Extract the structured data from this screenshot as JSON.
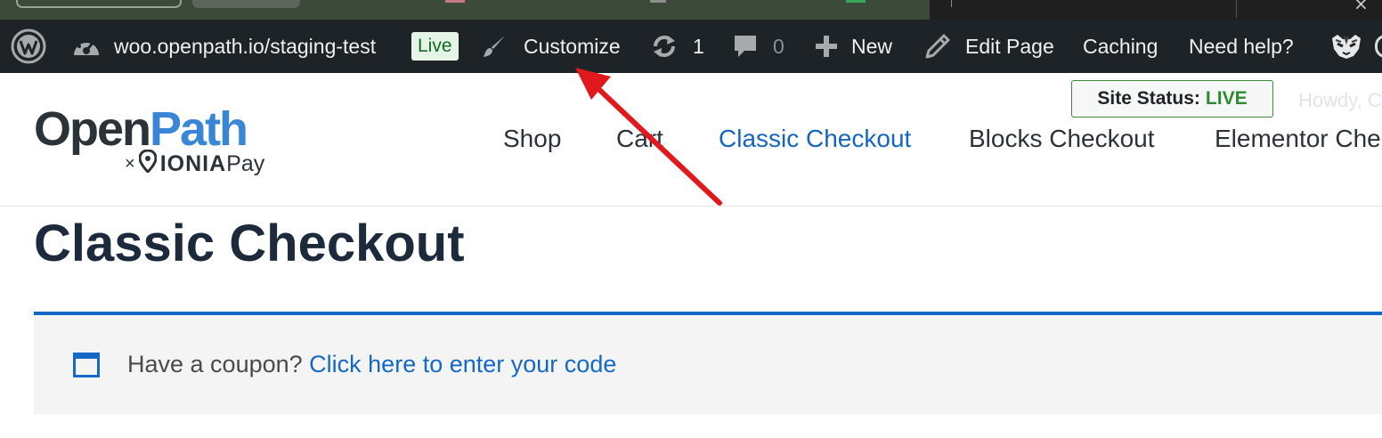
{
  "adminbar": {
    "site_url": "woo.openpath.io/staging-test",
    "live_badge": "Live",
    "customize": "Customize",
    "updates_count": "1",
    "comments_count": "0",
    "new": "New",
    "edit_page": "Edit Page",
    "caching": "Caching",
    "need_help": "Need help?"
  },
  "header": {
    "logo_open": "Open",
    "logo_path": "Path",
    "logo_x": "×",
    "logo_ionia": "IONIA",
    "logo_pay": "Pay",
    "site_status_label": "Site Status:",
    "site_status_value": "LIVE",
    "howdy": "Howdy, C",
    "nav": [
      "Shop",
      "Cart",
      "Classic Checkout",
      "Blocks Checkout",
      "Elementor Che"
    ]
  },
  "main": {
    "page_title": "Classic Checkout",
    "coupon_prompt": "Have a coupon?",
    "coupon_link": "Click here to enter your code"
  },
  "colors": {
    "admin_bar": "#1d2327",
    "accent_blue": "#1668c7",
    "live_green": "#2e8b2e",
    "annotation_red": "#e0191c"
  }
}
